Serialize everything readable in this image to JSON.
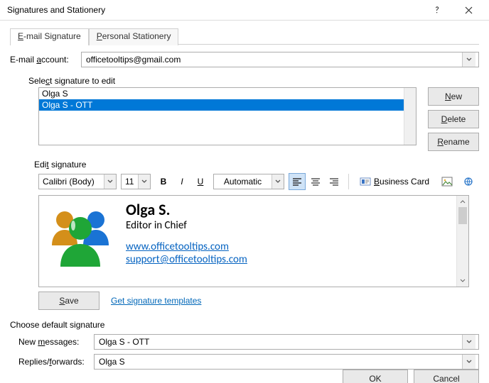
{
  "window": {
    "title": "Signatures and Stationery"
  },
  "tabs": {
    "email": "E-mail Signature",
    "stationery": "Personal Stationery"
  },
  "account": {
    "label": "E-mail account:",
    "value": "officetooltips@gmail.com"
  },
  "select_sig": {
    "caption": "Select signature to edit",
    "items": [
      "Olga S",
      "Olga S - OTT"
    ],
    "selected_index": 1
  },
  "buttons": {
    "new": "New",
    "delete": "Delete",
    "rename": "Rename",
    "save": "Save",
    "ok": "OK",
    "cancel": "Cancel"
  },
  "edit": {
    "caption": "Edit signature",
    "font": "Calibri (Body)",
    "size": "11",
    "color": "Automatic",
    "bizcard": "Business Card",
    "templates_link": "Get signature templates"
  },
  "sig_content": {
    "name": "Olga S.",
    "role": "Editor in Chief",
    "url": "www.officetooltips.com",
    "email": "support@officetooltips.com"
  },
  "defaults": {
    "caption": "Choose default signature",
    "new_label": "New messages:",
    "new_value": "Olga S - OTT",
    "replies_label": "Replies/forwards:",
    "replies_value": "Olga S"
  }
}
